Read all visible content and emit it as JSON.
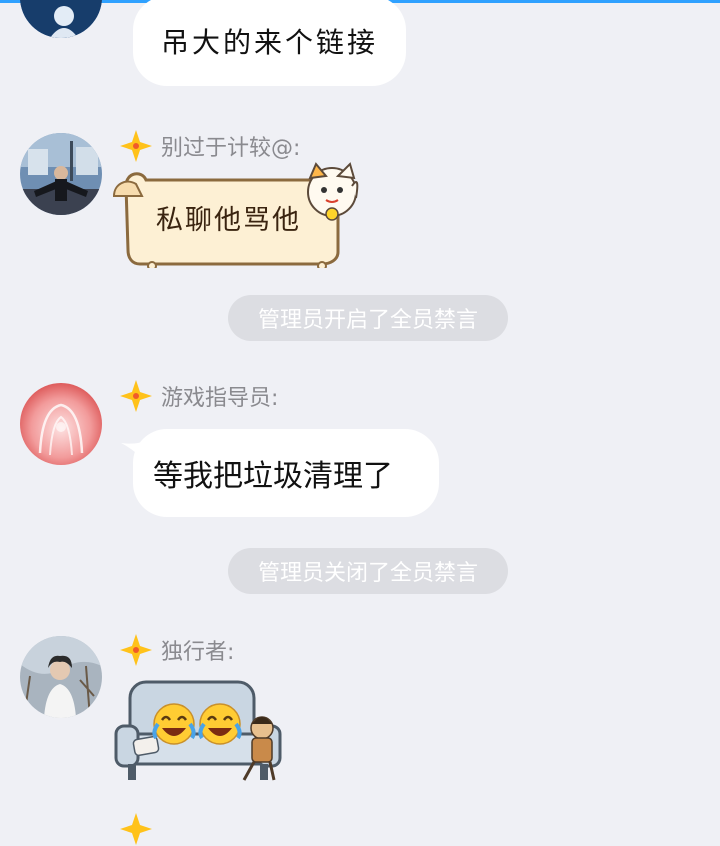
{
  "messages": [
    {
      "type": "text",
      "sender": "",
      "text": "吊大的来个链接"
    },
    {
      "type": "sticker",
      "sender": "别过于计较@:",
      "sticker_text": "私聊他骂他",
      "sticker": "lucky-cat-scroll-sticker"
    },
    {
      "type": "system",
      "text": "管理员开启了全员禁言"
    },
    {
      "type": "text",
      "sender": "游戏指导员:",
      "text": "等我把垃圾清理了"
    },
    {
      "type": "system",
      "text": "管理员关闭了全员禁言"
    },
    {
      "type": "sticker",
      "sender": "独行者:",
      "sticker": "laughing-sofa-sticker"
    }
  ],
  "colors": {
    "background": "#eff0f5",
    "accent_bar": "#2fa1ff",
    "bubble": "#ffffff",
    "system_pill": "#dcdde2",
    "nickname": "#8a8a8f",
    "badge": "#ffc21a"
  },
  "icons": [
    "member-badge-icon",
    "laughing-emoji-icon"
  ]
}
